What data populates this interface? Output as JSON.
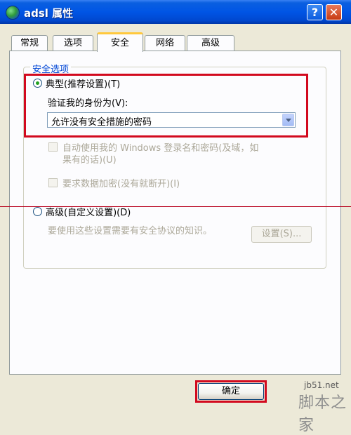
{
  "window": {
    "title": "adsl 属性",
    "help_label": "?",
    "close_label": "✕",
    "app_icon": "network-globe-icon"
  },
  "tabs": [
    {
      "label": "常规"
    },
    {
      "label": "选项"
    },
    {
      "label": "安全",
      "active": true
    },
    {
      "label": "网络"
    },
    {
      "label": "高级"
    }
  ],
  "security": {
    "group_title": "安全选项",
    "typical_label": "典型(推荐设置)(T)",
    "typical_selected": true,
    "verify_label": "验证我的身份为(V):",
    "verify_value": "允许没有安全措施的密码",
    "auto_logon_line1": "自动使用我的 Windows 登录名和密码(及域，如",
    "auto_logon_line2": "果有的话)(U)",
    "require_encryption": "要求数据加密(没有就断开)(I)",
    "advanced_label": "高级(自定义设置)(D)",
    "advanced_selected": false,
    "advanced_note": "要使用这些设置需要有安全协议的知识。",
    "settings_button": "设置(S)..."
  },
  "footer": {
    "ok_button": "确定"
  },
  "watermark": {
    "url": "jb51.net",
    "site": "脚本之家"
  },
  "colors": {
    "title_bar": "#0055E5",
    "highlight_box": "#D2091E",
    "group_title": "#0046D5",
    "dialog_bg": "#ECE9D8"
  }
}
